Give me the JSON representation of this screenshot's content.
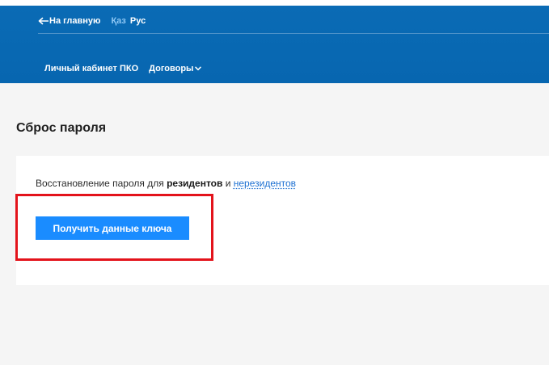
{
  "header": {
    "back_label": "На главную",
    "lang_kaz": "Қаз",
    "lang_rus": "Рус",
    "nav": [
      {
        "label": "Личный кабинет ПКО"
      },
      {
        "label": "Договоры"
      }
    ]
  },
  "main": {
    "title": "Сброс пароля",
    "reset_text_prefix": "Восстановление пароля для ",
    "residents": "резидентов",
    "and": " и ",
    "nonresidents": "нерезидентов",
    "button_label": "Получить данные ключа"
  },
  "colors": {
    "header_bg": "#0766b0",
    "button_bg": "#1a8cff",
    "link": "#1b6fd1",
    "highlight": "#e3131b"
  }
}
